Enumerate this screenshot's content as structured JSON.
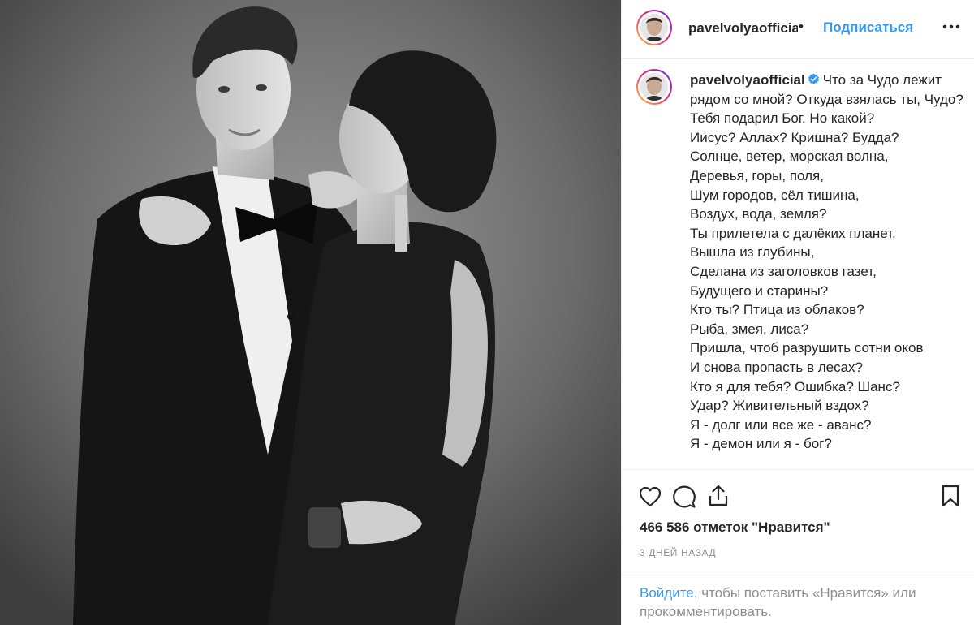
{
  "post": {
    "photo_alt": "Black and white photo of a couple",
    "header": {
      "username": "pavelvolyaofficia",
      "separator": "•",
      "follow_label": "Подписаться",
      "more_icon": "more-horizontal-icon"
    },
    "caption": {
      "username": "pavelvolyaofficial",
      "verified_icon": "verified-badge-icon",
      "first_line": "Что за Чудо лежит рядом со мной? Откуда взялась ты, Чудо?",
      "lines": [
        "Тебя подарил Бог. Но какой?",
        "Иисус? Аллах? Кришна? Будда?",
        "Солнце, ветер, морская волна,",
        "Деревья, горы, поля,",
        "Шум городов, сёл тишина,",
        "Воздух, вода, земля?",
        "Ты прилетела с далёких планет,",
        "Вышла из глубины,",
        "Сделана из заголовков газет,",
        "Будущего и старины?",
        "Кто ты? Птица из облаков?",
        "Рыба, змея, лиса?",
        "Пришла, чтоб разрушить сотни оков",
        "И снова пропасть в лесах?",
        "Кто я для тебя? Ошибка? Шанс?",
        "Удар? Живительный вздох?",
        "Я - долг или все же - аванс?",
        "Я - демон или я - бог?"
      ]
    },
    "actions": {
      "like_icon": "heart-icon",
      "comment_icon": "comment-icon",
      "share_icon": "share-icon",
      "save_icon": "bookmark-icon"
    },
    "likes_text": "466 586 отметок \"Нравится\"",
    "timestamp": "3 ДНЕЙ НАЗАД",
    "login_prompt": {
      "link": "Войдите",
      "rest": ", чтобы поставить «Нравится» или прокомментировать."
    }
  },
  "colors": {
    "link_blue": "#3897f0",
    "text": "#262626",
    "muted": "#8e8e8e",
    "border": "#efefef",
    "verified": "#3897f0"
  }
}
